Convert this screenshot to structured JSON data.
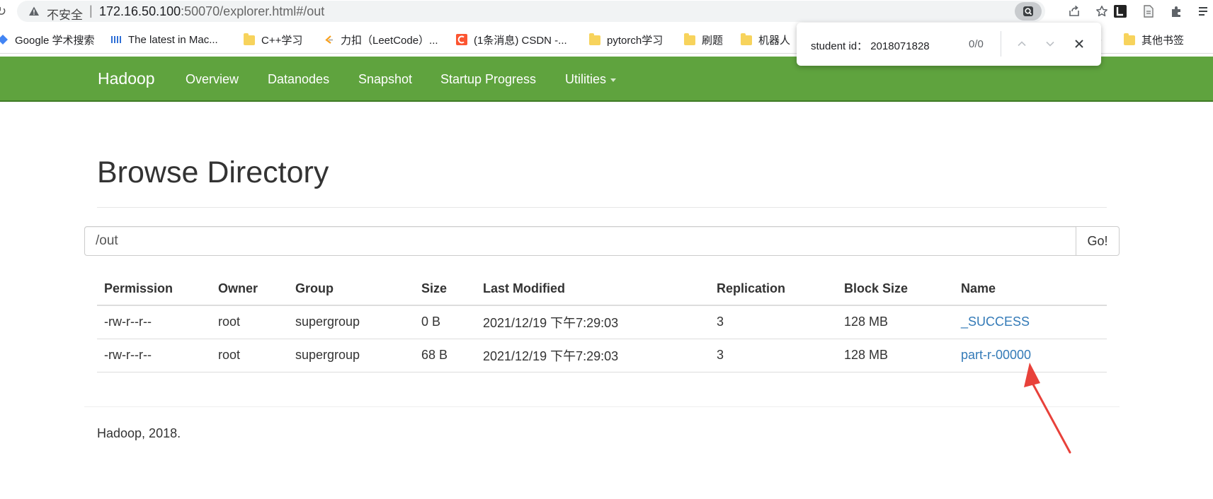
{
  "browser": {
    "security_label": "不安全",
    "url_host": "172.16.50.100",
    "url_rest": ":50070/explorer.html#/out",
    "bookmarks": [
      {
        "label": "Google 学术搜索",
        "icon": "google-scholar-icon"
      },
      {
        "label": "The latest in Mac...",
        "icon": "mac-site-icon"
      },
      {
        "label": "C++学习",
        "icon": "folder-icon"
      },
      {
        "label": "力扣（LeetCode）...",
        "icon": "leetcode-icon"
      },
      {
        "label": "(1条消息) CSDN -...",
        "icon": "csdn-icon"
      },
      {
        "label": "pytorch学习",
        "icon": "folder-icon"
      },
      {
        "label": "刷题",
        "icon": "folder-icon"
      },
      {
        "label": "机器人",
        "icon": "folder-icon"
      },
      {
        "label": "其他书签",
        "icon": "folder-icon"
      }
    ]
  },
  "find_bar": {
    "query": "student id： 2018071828",
    "count": "0/0"
  },
  "navbar": {
    "brand": "Hadoop",
    "links": [
      "Overview",
      "Datanodes",
      "Snapshot",
      "Startup Progress",
      "Utilities"
    ]
  },
  "main": {
    "title": "Browse Directory",
    "path_value": "/out",
    "go_label": "Go!"
  },
  "table": {
    "columns": [
      "Permission",
      "Owner",
      "Group",
      "Size",
      "Last Modified",
      "Replication",
      "Block Size",
      "Name"
    ],
    "rows": [
      {
        "permission": "-rw-r--r--",
        "owner": "root",
        "group": "supergroup",
        "size": "0 B",
        "modified": "2021/12/19 下午7:29:03",
        "replication": "3",
        "block_size": "128 MB",
        "name": "_SUCCESS"
      },
      {
        "permission": "-rw-r--r--",
        "owner": "root",
        "group": "supergroup",
        "size": "68 B",
        "modified": "2021/12/19 下午7:29:03",
        "replication": "3",
        "block_size": "128 MB",
        "name": "part-r-00000"
      }
    ]
  },
  "footer": {
    "text": "Hadoop, 2018."
  },
  "colors": {
    "navbar": "#5fa33e",
    "link": "#337ab7",
    "annotation_arrow": "#e8413a"
  }
}
